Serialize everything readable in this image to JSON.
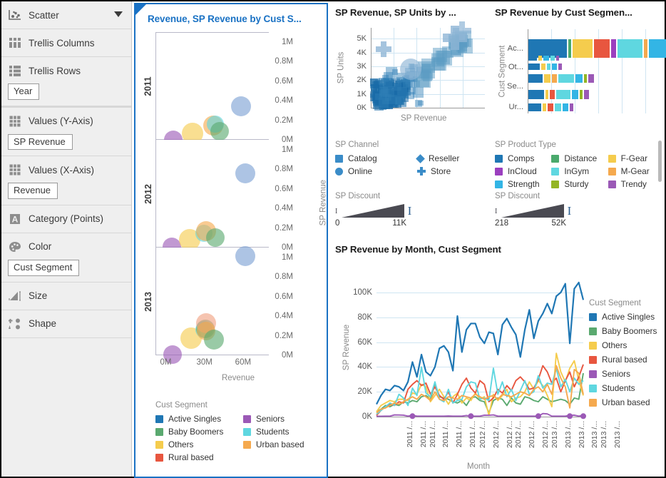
{
  "sidebar": {
    "chart_type": {
      "label": "Scatter",
      "icon": "scatter-icon"
    },
    "rows": [
      {
        "icon": "trellis-columns-icon",
        "label": "Trellis Columns",
        "chip": null
      },
      {
        "icon": "trellis-rows-icon",
        "label": "Trellis Rows",
        "chip": "Year"
      },
      {
        "icon": "values-icon",
        "label": "Values (Y-Axis)",
        "chip": "SP Revenue"
      },
      {
        "icon": "values-icon",
        "label": "Values (X-Axis)",
        "chip": "Revenue"
      },
      {
        "icon": "category-icon",
        "label": "Category (Points)",
        "chip": null
      },
      {
        "icon": "color-palette-icon",
        "label": "Color",
        "chip": "Cust Segment"
      },
      {
        "icon": "size-icon",
        "label": "Size",
        "chip": null
      },
      {
        "icon": "shape-icon",
        "label": "Shape",
        "chip": null
      }
    ]
  },
  "scatter_panel": {
    "title": "Revenue, SP Revenue by Cust S...",
    "legend_title": "Cust Segment",
    "legend": [
      {
        "label": "Active Singles",
        "color": "#1f77b4"
      },
      {
        "label": "Seniors",
        "color": "#9b59b6"
      },
      {
        "label": "Baby Boomers",
        "color": "#5aa96f"
      },
      {
        "label": "Students",
        "color": "#5fd7e0"
      },
      {
        "label": "Others",
        "color": "#f5cc4d"
      },
      {
        "label": "Urban based",
        "color": "#f5a94e"
      },
      {
        "label": "Rural based",
        "color": "#e8563f"
      }
    ]
  },
  "chart_data": [
    {
      "type": "scatter",
      "id": "trellis-scatter",
      "title": "Revenue, SP Revenue by Cust S...",
      "xlabel": "Revenue",
      "ylabel": "SP Revenue",
      "trellis_by": "Year",
      "color_by": "Cust Segment",
      "xlim": [
        -8000000,
        80000000
      ],
      "xticks": [
        "0M",
        "30M",
        "60M"
      ],
      "xtick_values": [
        0,
        30000000,
        60000000
      ],
      "yticks": [
        "0M",
        "0.2M",
        "0.4M",
        "0.6M",
        "0.8M",
        "1M"
      ],
      "ytick_values": [
        0,
        200000,
        400000,
        600000,
        800000,
        1000000
      ],
      "ylim": [
        0,
        1100000
      ],
      "panels": [
        {
          "label": "2011",
          "points": [
            {
              "segment": "Seniors",
              "color": "#9b59b6",
              "x": 5500000,
              "y": 5000,
              "r": 13
            },
            {
              "segment": "Others",
              "color": "#f5cc4d",
              "x": 20000000,
              "y": 75000,
              "r": 15
            },
            {
              "segment": "Urban based",
              "color": "#f5a94e",
              "x": 36000000,
              "y": 150000,
              "r": 14
            },
            {
              "segment": "Students",
              "color": "#5fd7e0",
              "x": 38000000,
              "y": 170000,
              "r": 12
            },
            {
              "segment": "Baby Boomers",
              "color": "#5aa96f",
              "x": 41000000,
              "y": 95000,
              "r": 13
            },
            {
              "segment": "Active Singles",
              "color": "#7b9fd4",
              "x": 58000000,
              "y": 350000,
              "r": 14
            }
          ]
        },
        {
          "label": "2012",
          "points": [
            {
              "segment": "Seniors",
              "color": "#9b59b6",
              "x": 4000000,
              "y": 5000,
              "r": 13
            },
            {
              "segment": "Others",
              "color": "#f5cc4d",
              "x": 18000000,
              "y": 80000,
              "r": 15
            },
            {
              "segment": "Students",
              "color": "#5fd7e0",
              "x": 29000000,
              "y": 145000,
              "r": 12
            },
            {
              "segment": "Urban based",
              "color": "#f5a94e",
              "x": 31000000,
              "y": 165000,
              "r": 14
            },
            {
              "segment": "Baby Boomers",
              "color": "#5aa96f",
              "x": 38000000,
              "y": 100000,
              "r": 13
            },
            {
              "segment": "Active Singles",
              "color": "#7b9fd4",
              "x": 61000000,
              "y": 760000,
              "r": 14
            }
          ]
        },
        {
          "label": "2013",
          "points": [
            {
              "segment": "Seniors",
              "color": "#9b59b6",
              "x": 5000000,
              "y": 5000,
              "r": 13
            },
            {
              "segment": "Others",
              "color": "#f5cc4d",
              "x": 19000000,
              "y": 175000,
              "r": 15
            },
            {
              "segment": "Students",
              "color": "#5fd7e0",
              "x": 29000000,
              "y": 260000,
              "r": 12
            },
            {
              "segment": "Baby Boomers",
              "color": "#5aa96f",
              "x": 30000000,
              "y": 270000,
              "r": 13
            },
            {
              "segment": "Rural based",
              "color": "#f0a080",
              "x": 31000000,
              "y": 330000,
              "r": 14
            },
            {
              "segment": "Urban based",
              "color": "#f5a94e",
              "x": 30500000,
              "y": 250000,
              "r": 13
            },
            {
              "segment": "Baby Boomers",
              "color": "#5aa96f",
              "x": 37000000,
              "y": 160000,
              "r": 14
            },
            {
              "segment": "Active Singles",
              "color": "#7b9fd4",
              "x": 61000000,
              "y": 1010000,
              "r": 14
            }
          ]
        }
      ]
    },
    {
      "type": "scatter",
      "id": "sp-units-scatter",
      "title": "SP Revenue, SP Units by ...",
      "xlabel": "SP Revenue",
      "ylabel": "SP Units",
      "yticks": [
        "0K",
        "1K",
        "2K",
        "3K",
        "4K",
        "5K"
      ],
      "ytick_values": [
        0,
        1000,
        2000,
        3000,
        4000,
        5000
      ],
      "ylim": [
        0,
        5800
      ],
      "legend_title": "SP Channel",
      "legend": [
        {
          "label": "Catalog",
          "shape": "square",
          "color": "#3a8cc8"
        },
        {
          "label": "Reseller",
          "shape": "diamond",
          "color": "#3a8cc8"
        },
        {
          "label": "Online",
          "shape": "circle",
          "color": "#3a8cc8"
        },
        {
          "label": "Store",
          "shape": "plus",
          "color": "#3a8cc8"
        }
      ]
    },
    {
      "type": "bar",
      "id": "sp-revenue-cust-segment-bar",
      "title": "SP Revenue by Cust Segmen...",
      "ylabel": "Cust Segment",
      "categories": [
        "Ac...",
        "Ot...",
        "Se...",
        "Ur..."
      ],
      "legend_title": "SP Product Type",
      "legend": [
        {
          "label": "Comps",
          "color": "#1f77b4"
        },
        {
          "label": "InCloud",
          "color": "#9b3fbf"
        },
        {
          "label": "Strength",
          "color": "#33b5e5"
        },
        {
          "label": "Distance",
          "color": "#4aa96c"
        },
        {
          "label": "InGym",
          "color": "#5fd7e0"
        },
        {
          "label": "Sturdy",
          "color": "#94b524"
        },
        {
          "label": "F-Gear",
          "color": "#f5cc4d"
        },
        {
          "label": "M-Gear",
          "color": "#f5a94e"
        },
        {
          "label": "Trendy",
          "color": "#9b59b6"
        }
      ]
    },
    {
      "type": "line",
      "id": "sp-revenue-by-month",
      "title": "SP Revenue by Month, Cust Segment",
      "xlabel": "Month",
      "ylabel": "SP Revenue",
      "yticks": [
        "0K",
        "20K",
        "40K",
        "60K",
        "80K",
        "100K"
      ],
      "ytick_values": [
        0,
        20000,
        40000,
        60000,
        80000,
        100000
      ],
      "ylim": [
        0,
        112000
      ],
      "xtick_labels": [
        "2011 /...",
        "2011 /...",
        "2011 /...",
        "2011 /...",
        "2011 /...",
        "2011 /...",
        "2012 /...",
        "2012 /...",
        "2012 /...",
        "2012 /...",
        "2012 /...",
        "2012 /...",
        "2013 /...",
        "2013 /...",
        "2013 /...",
        "2013 /...",
        "2013 /...",
        "2013 /..."
      ],
      "legend_title": "Cust Segment",
      "series": [
        {
          "name": "Active Singles",
          "color": "#1f77b4",
          "values": [
            10000,
            17000,
            22000,
            21000,
            25000,
            24000,
            21000,
            28000,
            44000,
            32000,
            50000,
            36000,
            33000,
            40000,
            55000,
            57000,
            52000,
            37000,
            81000,
            52000,
            70000,
            75000,
            75000,
            64000,
            59000,
            68000,
            67000,
            50000,
            74000,
            79000,
            72000,
            66000,
            48000,
            70000,
            86000,
            63000,
            77000,
            83000,
            91000,
            83000,
            97000,
            100000,
            107000,
            59000,
            103000,
            108000,
            94000
          ]
        },
        {
          "name": "Baby Boomers",
          "color": "#5aa96f",
          "values": [
            4000,
            6000,
            9000,
            8000,
            10000,
            9000,
            12000,
            11000,
            13000,
            12000,
            16000,
            17000,
            14000,
            27000,
            16000,
            15000,
            14000,
            12000,
            11000,
            13000,
            9000,
            15000,
            16000,
            13000,
            12000,
            3000,
            13000,
            15000,
            14000,
            9000,
            15000,
            11000,
            10000,
            16000,
            15000,
            13000,
            12000,
            16000,
            14000,
            12000,
            13000,
            14000,
            13000,
            10000,
            15000,
            14000,
            35000
          ]
        },
        {
          "name": "Others",
          "color": "#f5cc4d",
          "values": [
            4000,
            9000,
            11000,
            13000,
            12000,
            14000,
            14000,
            13000,
            19000,
            18000,
            26000,
            24000,
            12000,
            17000,
            22000,
            16000,
            10000,
            16000,
            19000,
            11000,
            15000,
            13000,
            19000,
            14000,
            16000,
            1000,
            18000,
            13000,
            17000,
            22000,
            12000,
            15000,
            16000,
            20000,
            28000,
            22000,
            29000,
            25000,
            17000,
            8000,
            51000,
            36000,
            28000,
            39000,
            45000,
            29000,
            17000
          ]
        },
        {
          "name": "Rural based",
          "color": "#e8563f",
          "values": [
            1000,
            5000,
            8000,
            10000,
            9000,
            12000,
            11000,
            22000,
            26000,
            29000,
            25000,
            27000,
            18000,
            24000,
            17000,
            14000,
            20000,
            11000,
            18000,
            26000,
            31000,
            23000,
            19000,
            29000,
            26000,
            12000,
            15000,
            22000,
            19000,
            25000,
            21000,
            29000,
            32000,
            28000,
            22000,
            23000,
            30000,
            41000,
            36000,
            27000,
            31000,
            20000,
            29000,
            36000,
            24000,
            32000,
            42000
          ]
        },
        {
          "name": "Seniors",
          "color": "#9b59b6",
          "values": [
            300,
            300,
            400,
            400,
            1400,
            1300,
            1200,
            400,
            1100,
            400,
            400,
            400,
            400,
            400,
            400,
            400,
            500,
            400,
            400,
            400,
            900,
            400,
            400,
            400,
            1200,
            1100,
            1400,
            400,
            400,
            400,
            400,
            400,
            400,
            400,
            400,
            400,
            400,
            2500,
            2200,
            400,
            400,
            400,
            400,
            1100,
            1200,
            400,
            1100
          ]
        },
        {
          "name": "Students",
          "color": "#5fd7e0",
          "values": [
            2000,
            5000,
            8000,
            11000,
            9000,
            18000,
            15000,
            9000,
            23000,
            17000,
            40000,
            19000,
            16000,
            28000,
            14000,
            12000,
            22000,
            11000,
            13000,
            14000,
            24000,
            28000,
            27000,
            14000,
            15000,
            13000,
            39000,
            18000,
            28000,
            16000,
            22000,
            13000,
            21000,
            29000,
            18000,
            20000,
            33000,
            23000,
            27000,
            26000,
            39000,
            24000,
            30000,
            20000,
            31000,
            26000,
            29000
          ]
        },
        {
          "name": "Urban based",
          "color": "#f5a94e",
          "values": [
            3000,
            6000,
            7000,
            9000,
            11000,
            10000,
            12000,
            14000,
            16000,
            14000,
            18000,
            16000,
            13000,
            20000,
            14000,
            13000,
            16000,
            15000,
            14000,
            17000,
            16000,
            15000,
            18000,
            16000,
            14000,
            16000,
            17000,
            14000,
            18000,
            17000,
            16000,
            18000,
            20000,
            19000,
            17000,
            22000,
            24000,
            20000,
            26000,
            18000,
            41000,
            31000,
            24000,
            7000,
            38000,
            35000,
            18000
          ]
        }
      ]
    }
  ],
  "sliders": [
    {
      "title": "SP Discount",
      "min": "0",
      "max": "11K"
    },
    {
      "title": "SP Discount",
      "min": "218",
      "max": "52K"
    }
  ]
}
